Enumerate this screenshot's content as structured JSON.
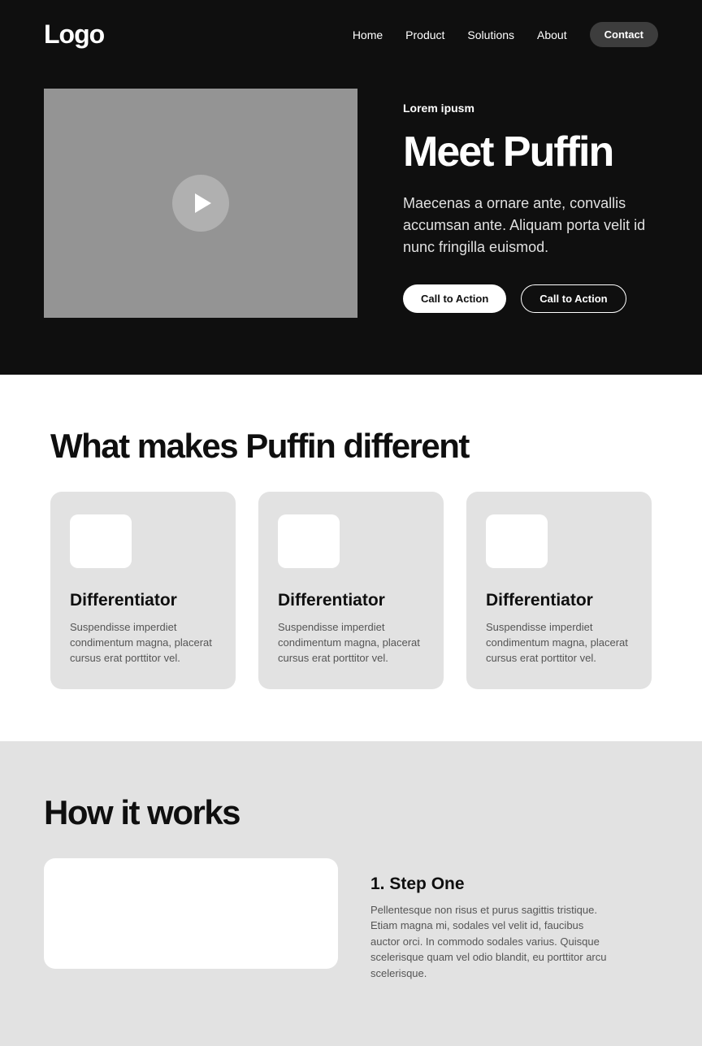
{
  "nav": {
    "logo": "Logo",
    "links": [
      "Home",
      "Product",
      "Solutions",
      "About"
    ],
    "contact": "Contact"
  },
  "hero": {
    "eyebrow": "Lorem ipusm",
    "title": "Meet Puffin",
    "desc": "Maecenas a ornare ante, convallis accumsan ante. Aliquam porta velit id nunc fringilla euismod.",
    "cta_primary": "Call to Action",
    "cta_secondary": "Call to Action"
  },
  "diff": {
    "title": "What makes Puffin different",
    "cards": [
      {
        "title": "Differentiator",
        "desc": "Suspendisse imperdiet condimentum magna, placerat cursus erat porttitor vel."
      },
      {
        "title": "Differentiator",
        "desc": "Suspendisse imperdiet condimentum magna, placerat cursus erat porttitor vel."
      },
      {
        "title": "Differentiator",
        "desc": "Suspendisse imperdiet condimentum magna, placerat cursus erat porttitor vel."
      }
    ]
  },
  "how": {
    "title": "How it works",
    "step1_title": "1. Step One",
    "step1_desc": "Pellentesque non risus et purus sagittis tristique. Etiam magna mi, sodales vel velit id, faucibus auctor orci. In commodo sodales varius. Quisque scelerisque quam vel odio blandit, eu porttitor arcu scelerisque."
  }
}
